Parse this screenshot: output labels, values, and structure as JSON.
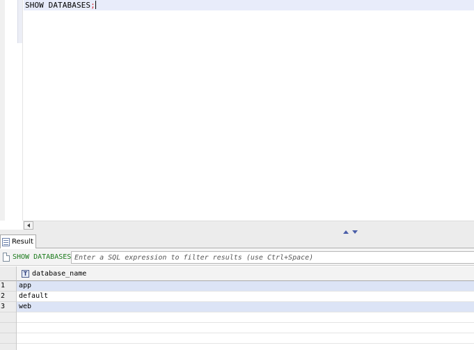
{
  "editor": {
    "keyword": "SHOW DATABASES",
    "terminator": ";"
  },
  "result_tab": {
    "label": "Result"
  },
  "filter": {
    "query": "SHOW DATABASES",
    "placeholder": "Enter a SQL expression to filter results (use Ctrl+Space)"
  },
  "grid": {
    "column": {
      "name": "database_name",
      "type_icon": "T"
    },
    "rows": [
      {
        "num": "1",
        "value": "app"
      },
      {
        "num": "2",
        "value": "default"
      },
      {
        "num": "3",
        "value": "web"
      }
    ]
  },
  "colors": {
    "current_line": "#e8ecfa",
    "row_highlight": "#dce4f6",
    "query_green": "#1a7a1a",
    "semicolon_red": "#e0202a",
    "splitter_arrows": "#4a5ea8"
  }
}
